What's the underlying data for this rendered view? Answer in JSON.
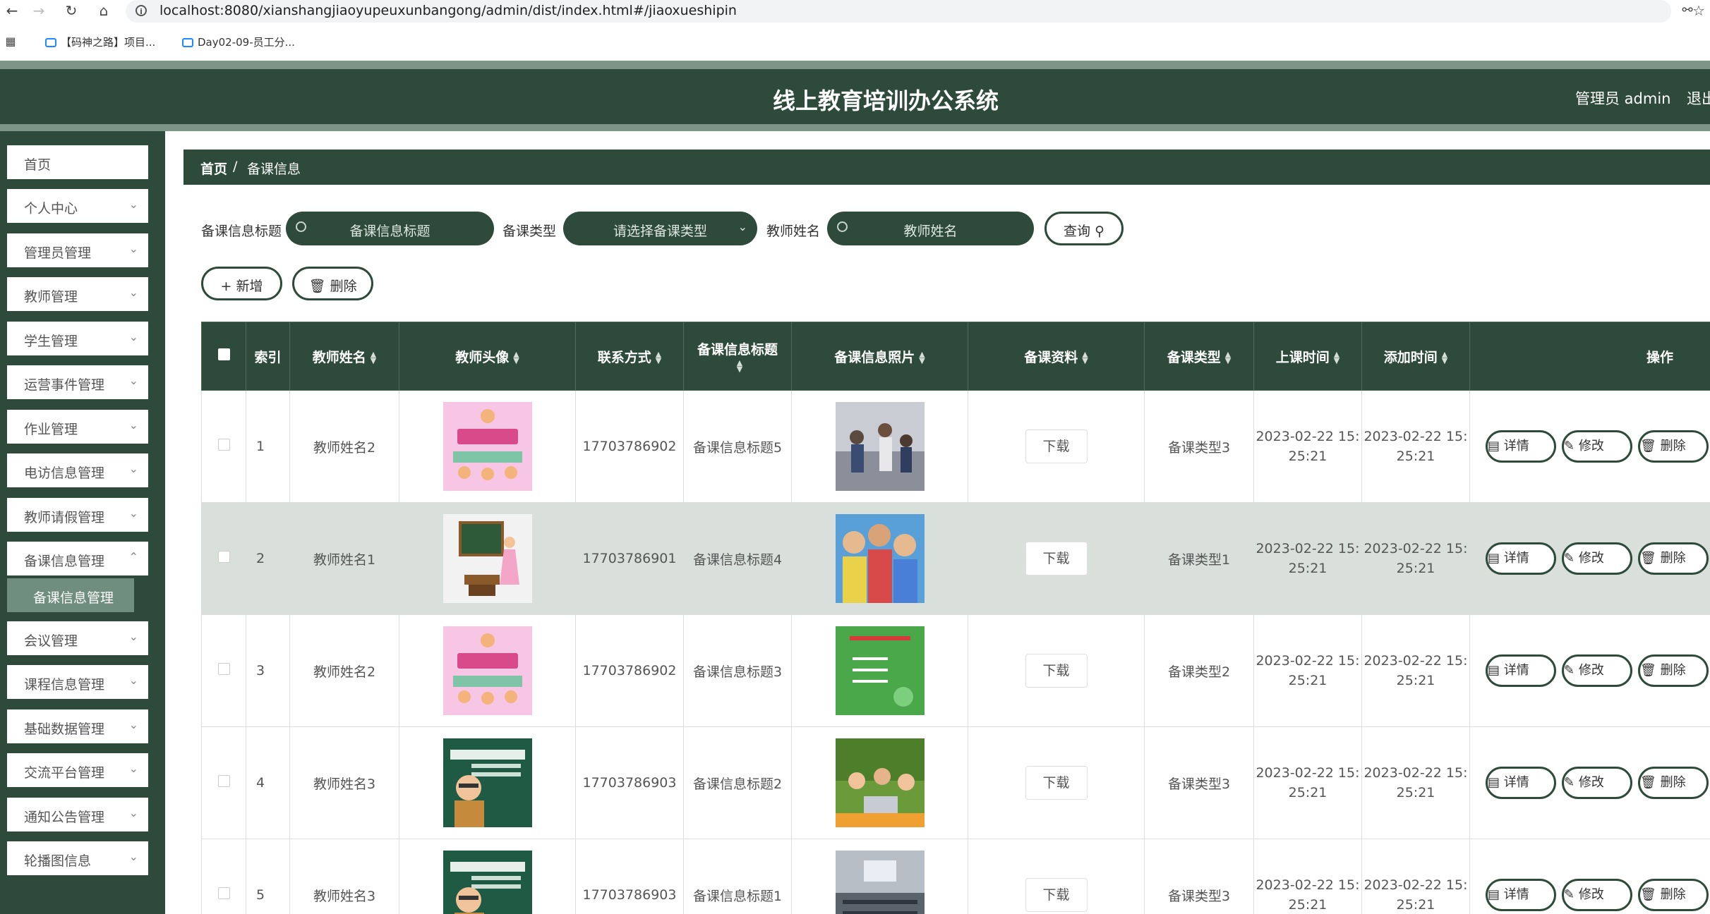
{
  "browser": {
    "url": "localhost:8080/xianshangjiaoyupeuxunbangong/admin/dist/index.html#/jiaoxueshipin",
    "bookmarks": [
      "【码神之路】项目...",
      "Day02-09-员工分..."
    ]
  },
  "header": {
    "title": "线上教育培训办公系统",
    "user": "管理员 admin",
    "logout": "退出"
  },
  "sidebar": {
    "items": [
      {
        "label": "首页"
      },
      {
        "label": "个人中心"
      },
      {
        "label": "管理员管理"
      },
      {
        "label": "教师管理"
      },
      {
        "label": "学生管理"
      },
      {
        "label": "运营事件管理"
      },
      {
        "label": "作业管理"
      },
      {
        "label": "电访信息管理"
      },
      {
        "label": "教师请假管理"
      },
      {
        "label": "备课信息管理"
      },
      {
        "label": "会议管理"
      },
      {
        "label": "课程信息管理"
      },
      {
        "label": "基础数据管理"
      },
      {
        "label": "交流平台管理"
      },
      {
        "label": "通知公告管理"
      },
      {
        "label": "轮播图信息"
      }
    ],
    "active_sub": "备课信息管理"
  },
  "breadcrumb": {
    "home": "首页",
    "sep": "/",
    "current": "备课信息"
  },
  "search": {
    "title_label": "备课信息标题",
    "title_placeholder": "备课信息标题",
    "type_label": "备课类型",
    "type_placeholder": "请选择备课类型",
    "teacher_label": "教师姓名",
    "teacher_placeholder": "教师姓名",
    "query_button": "查询"
  },
  "actions": {
    "add": "新增",
    "delete": "删除"
  },
  "table": {
    "headers": {
      "index": "索引",
      "teacher_name": "教师姓名",
      "teacher_avatar": "教师头像",
      "contact": "联系方式",
      "title": "备课信息标题",
      "photo": "备课信息照片",
      "material": "备课资料",
      "type": "备课类型",
      "class_time": "上课时间",
      "add_time": "添加时间",
      "ops": "操作"
    },
    "download_label": "下载",
    "detail_label": "详情",
    "edit_label": "修改",
    "delete_label": "删除",
    "rows": [
      {
        "index": "1",
        "teacher_name": "教师姓名2",
        "contact": "17703786902",
        "title": "备课信息标题5",
        "type": "备课类型3",
        "class_time_1": "2023-02-22 15:",
        "class_time_2": "25:21",
        "add_time_1": "2023-02-22 15:",
        "add_time_2": "25:21"
      },
      {
        "index": "2",
        "teacher_name": "教师姓名1",
        "contact": "17703786901",
        "title": "备课信息标题4",
        "type": "备课类型1",
        "class_time_1": "2023-02-22 15:",
        "class_time_2": "25:21",
        "add_time_1": "2023-02-22 15:",
        "add_time_2": "25:21"
      },
      {
        "index": "3",
        "teacher_name": "教师姓名2",
        "contact": "17703786902",
        "title": "备课信息标题3",
        "type": "备课类型2",
        "class_time_1": "2023-02-22 15:",
        "class_time_2": "25:21",
        "add_time_1": "2023-02-22 15:",
        "add_time_2": "25:21"
      },
      {
        "index": "4",
        "teacher_name": "教师姓名3",
        "contact": "17703786903",
        "title": "备课信息标题2",
        "type": "备课类型3",
        "class_time_1": "2023-02-22 15:",
        "class_time_2": "25:21",
        "add_time_1": "2023-02-22 15:",
        "add_time_2": "25:21"
      },
      {
        "index": "5",
        "teacher_name": "教师姓名3",
        "contact": "17703786903",
        "title": "备课信息标题1",
        "type": "备课类型3",
        "class_time_1": "2023-02-22 15:",
        "class_time_2": "25:21",
        "add_time_1": "2023-02-22 15:",
        "add_time_2": "25:21"
      }
    ]
  },
  "colors": {
    "primary": "#2d4a3a",
    "accent_strip": "#7c9586",
    "row_alt": "#d9e0db"
  }
}
